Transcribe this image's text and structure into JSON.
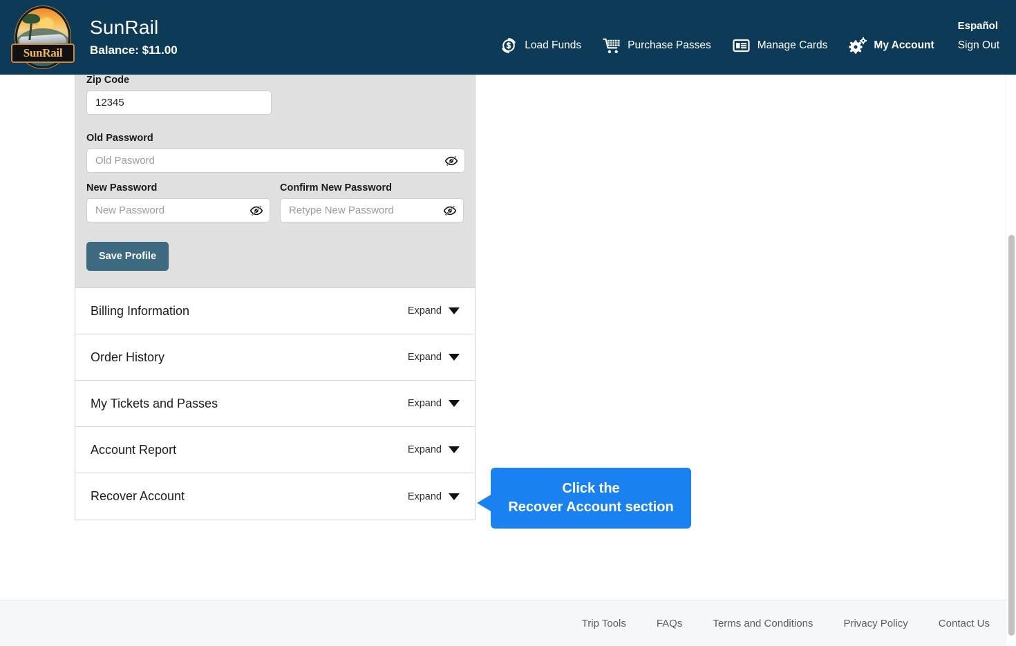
{
  "header": {
    "logo_text": "SunRail",
    "brand_title": "SunRail",
    "balance": "Balance: $11.00",
    "language_link": "Español",
    "sign_out": "Sign Out",
    "nav": [
      {
        "label": "Load Funds",
        "icon": "load-funds-icon",
        "active": false
      },
      {
        "label": "Purchase Passes",
        "icon": "shopping-cart-icon",
        "active": false
      },
      {
        "label": "Manage Cards",
        "icon": "card-list-icon",
        "active": false
      },
      {
        "label": "My Account",
        "icon": "gear-icon",
        "active": true
      }
    ]
  },
  "profile_form": {
    "zip_label": "Zip Code",
    "zip_value": "12345",
    "zip_placeholder": "Zip Code",
    "old_password_label": "Old Password",
    "old_password_placeholder": "Old Pasword",
    "old_password_value": "",
    "new_password_label": "New Password",
    "new_password_placeholder": "New Password",
    "new_password_value": "",
    "confirm_password_label": "Confirm New Password",
    "confirm_password_placeholder": "Retype New Password",
    "confirm_password_value": "",
    "save_button": "Save Profile"
  },
  "accordion": {
    "expand_label": "Expand",
    "sections": [
      {
        "title": "Billing Information",
        "action": "Expand"
      },
      {
        "title": "Order History",
        "action": "Expand"
      },
      {
        "title": "My Tickets and Passes",
        "action": "Expand"
      },
      {
        "title": "Account Report",
        "action": "Expand"
      },
      {
        "title": "Recover Account",
        "action": "Expand"
      }
    ]
  },
  "callout": {
    "line1": "Click the",
    "line2": "Recover Account section",
    "color": "#1a82f0"
  },
  "footer": {
    "links": [
      "Trip Tools",
      "FAQs",
      "Terms and Conditions",
      "Privacy Policy",
      "Contact Us"
    ]
  },
  "colors": {
    "header_bg": "#0d3a56",
    "form_bg": "#e0e0e0",
    "save_button": "#3d6a80",
    "callout_blue": "#1a82f0",
    "footer_bg": "#f5f7f9"
  }
}
